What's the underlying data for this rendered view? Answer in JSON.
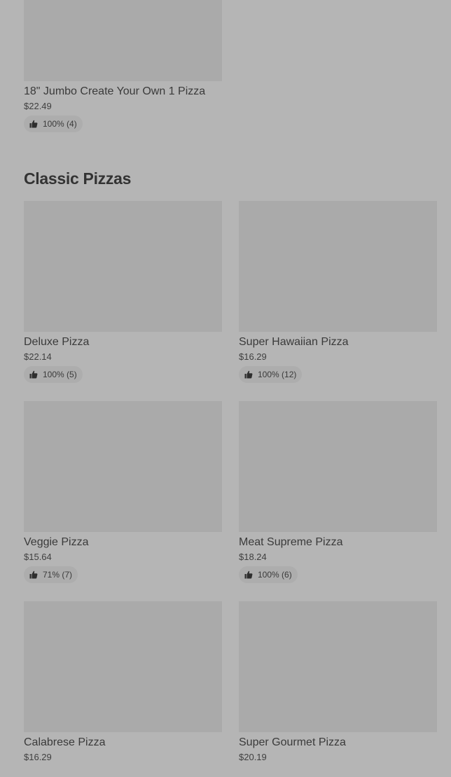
{
  "top_item": {
    "name": "18\" Jumbo Create Your Own 1 Pizza",
    "price": "$22.49",
    "rating": "100% (4)"
  },
  "section": {
    "title": "Classic Pizzas"
  },
  "items": [
    {
      "name": "Deluxe Pizza",
      "price": "$22.14",
      "rating": "100% (5)"
    },
    {
      "name": "Super Hawaiian Pizza",
      "price": "$16.29",
      "rating": "100% (12)"
    },
    {
      "name": "Veggie Pizza",
      "price": "$15.64",
      "rating": "71% (7)"
    },
    {
      "name": "Meat Supreme Pizza",
      "price": "$18.24",
      "rating": "100% (6)"
    },
    {
      "name": "Calabrese Pizza",
      "price": "$16.29"
    },
    {
      "name": "Super Gourmet Pizza",
      "price": "$20.19"
    }
  ],
  "icons": {
    "rating": "thumbs-up-icon"
  },
  "colors": {
    "background": "#b5b5b5",
    "image_placeholder": "#aaaaaa",
    "text": "#3a3a3a"
  }
}
